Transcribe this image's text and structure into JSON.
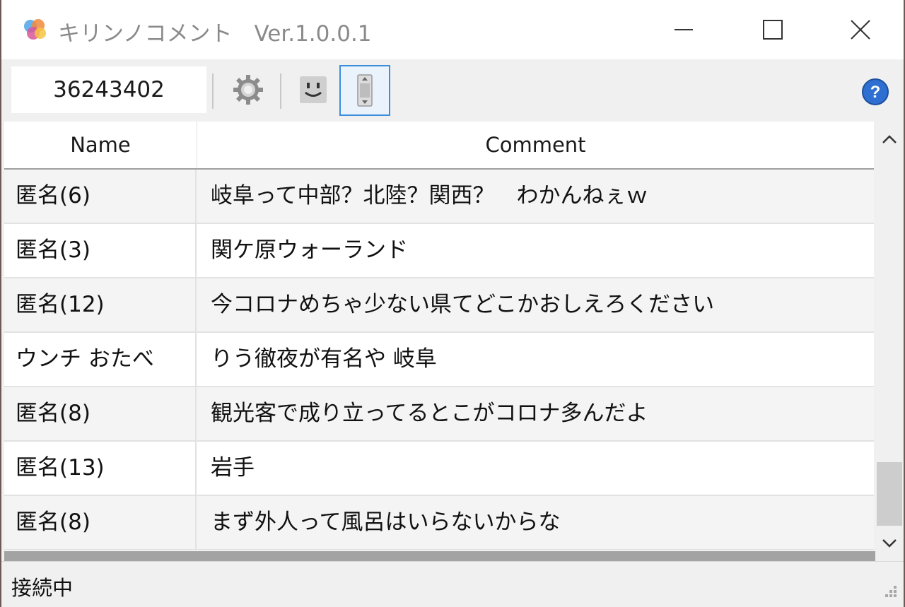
{
  "window": {
    "title": "キリンノコメント　Ver.1.0.0.1"
  },
  "toolbar": {
    "room_id_value": "36243402",
    "buttons": [
      {
        "icon": "gear-icon"
      },
      {
        "icon": "smiley-icon"
      },
      {
        "icon": "scroll-toggle-icon",
        "active": true
      }
    ],
    "help_icon": "help-icon"
  },
  "grid": {
    "columns": [
      "Name",
      "Comment"
    ],
    "rows": [
      {
        "name": "匿名(6)",
        "comment": "岐阜って中部？北陸？関西？　わかんねぇｗ"
      },
      {
        "name": "匿名(3)",
        "comment": "関ケ原ウォーランド"
      },
      {
        "name": "匿名(12)",
        "comment": "今コロナめちゃ少ない県てどこかおしえろください"
      },
      {
        "name": "ウンチ おたべ",
        "comment": "りう徹夜が有名や 岐阜"
      },
      {
        "name": "匿名(8)",
        "comment": "観光客で成り立ってるとこがコロナ多んだよ"
      },
      {
        "name": "匿名(13)",
        "comment": "岩手"
      },
      {
        "name": "匿名(8)",
        "comment": "まず外人って風呂はいらないからな"
      }
    ]
  },
  "status": {
    "text": "接続中"
  },
  "colors": {
    "accent": "#3c8fdc",
    "help": "#2f6fd1",
    "row_alt": "#f4f4f4"
  }
}
